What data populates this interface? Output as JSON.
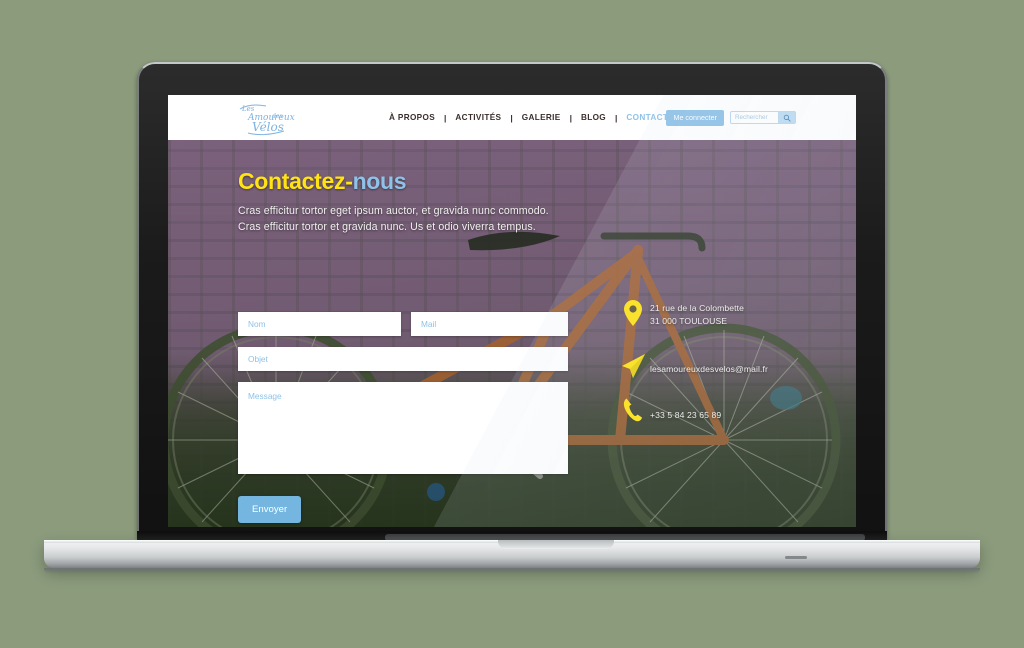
{
  "page": {
    "background_color": "#8b9b7c",
    "device": "laptop-mockup"
  },
  "header": {
    "logo_alt": "Les Amoureux des Vélos",
    "nav": [
      {
        "label": "À PROPOS",
        "active": false
      },
      {
        "label": "ACTIVITÉS",
        "active": false
      },
      {
        "label": "GALERIE",
        "active": false
      },
      {
        "label": "BLOG",
        "active": false
      },
      {
        "label": "CONTACT",
        "active": true
      }
    ],
    "separator": "|",
    "login_label": "Me connecter",
    "search_placeholder": "Rechercher",
    "search_value": "",
    "search_icon": "magnifier-icon",
    "accent_color": "#8ec2e8"
  },
  "hero": {
    "title_part1": "Contactez-",
    "title_part2": "nous",
    "title_color_1": "#ffe313",
    "title_color_2": "#8ec2e8",
    "subtitle_line1": "Cras efficitur tortor eget ipsum auctor, et gravida nunc commodo.",
    "subtitle_line2": "Cras efficitur tortor et gravida nunc. Us et odio viverra tempus."
  },
  "form": {
    "nom_placeholder": "Nom",
    "nom_value": "",
    "mail_placeholder": "Mail",
    "mail_value": "",
    "objet_placeholder": "Objet",
    "objet_value": "",
    "message_placeholder": "Message",
    "message_value": "",
    "submit_label": "Envoyer",
    "submit_color": "#74b6e0"
  },
  "contact_info": {
    "icon_color": "#ffe313",
    "address_icon": "location-pin-icon",
    "address_line1": "21 rue de la Colombette",
    "address_line2": "31 000 TOULOUSE",
    "mail_icon": "paper-plane-icon",
    "email": "lesamoureuxdesvelos@mail.fr",
    "phone_icon": "phone-handset-icon",
    "phone": "+33 5 84 23 65 89"
  }
}
